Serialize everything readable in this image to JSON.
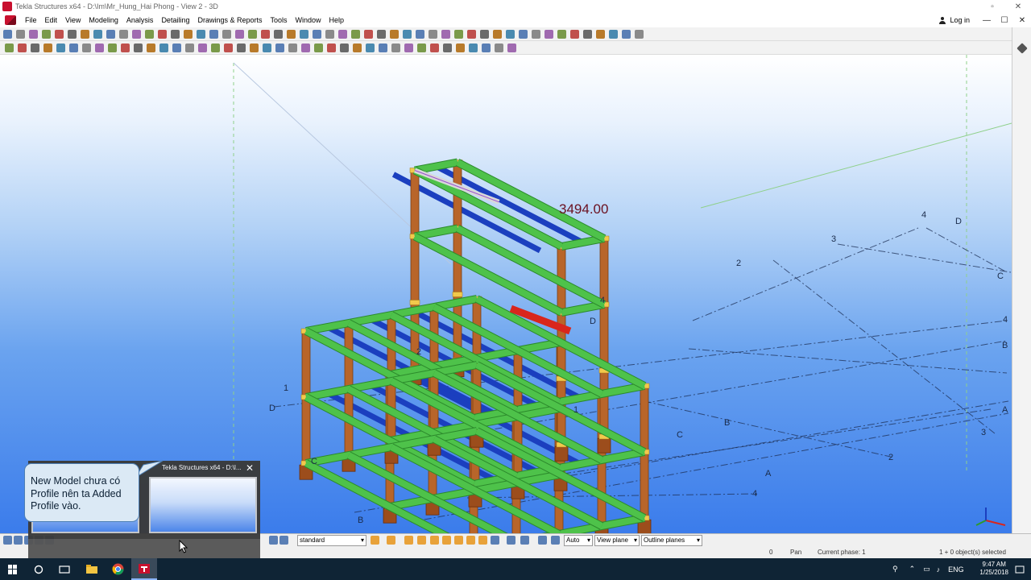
{
  "window": {
    "title": "Tekla Structures x64 - D:\\Im\\Mr_Hung_Hai Phong  - View 2 - 3D",
    "login_label": "Log in"
  },
  "menu": {
    "items": [
      "File",
      "Edit",
      "View",
      "Modeling",
      "Analysis",
      "Detailing",
      "Drawings & Reports",
      "Tools",
      "Window",
      "Help"
    ]
  },
  "viewport": {
    "dimension_label": "3494.00",
    "grid_labels": {
      "left": [
        "1",
        "D",
        "C",
        "B"
      ],
      "right": [
        "4",
        "D",
        "3",
        "2",
        "C",
        "4",
        "B",
        "A",
        "3",
        "2",
        "A",
        "4",
        "B",
        "C",
        "D",
        "2",
        "1",
        "4"
      ]
    }
  },
  "bottom_toolbar": {
    "filter": "standard",
    "snap_mode": "Auto",
    "plane_mode": "View plane",
    "outline_mode": "Outline planes"
  },
  "statusbar": {
    "number": "0",
    "mode": "Pan",
    "phase": "Current phase: 1",
    "selection": "1 + 0 object(s) selected"
  },
  "taskbar": {
    "language": "ENG",
    "time": "9:47 AM",
    "date": "1/25/2018",
    "thumbnail_title": "Tekla Structures x64 - D:\\I..."
  },
  "callout": {
    "text": "New Model chưa có Profile nên ta Added Profile vào."
  },
  "colors": {
    "beam_green": "#4ec24a",
    "beam_blue": "#1b3fbf",
    "column_orange": "#b8652a",
    "selected_red": "#d9261c",
    "taskbar_bg": "#0f2435"
  }
}
